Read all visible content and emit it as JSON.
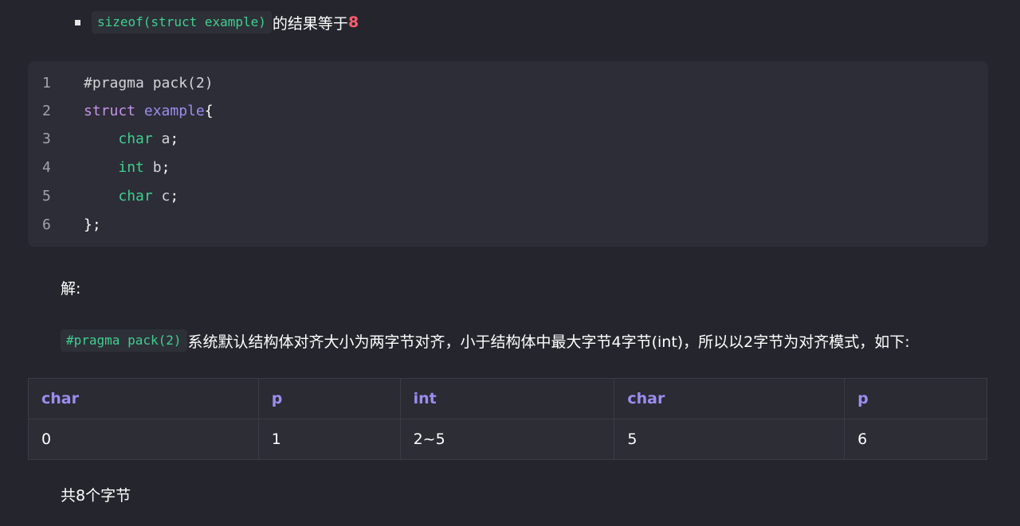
{
  "bullet": {
    "code": "sizeof(struct example)",
    "text": "的结果等于",
    "result": "8"
  },
  "code_block": {
    "lines": [
      {
        "n": "1",
        "parts": [
          "#pragma pack(2)"
        ]
      },
      {
        "n": "2",
        "parts": [
          "struct",
          " ",
          "example",
          "{"
        ]
      },
      {
        "n": "3",
        "parts": [
          "    ",
          "char",
          " a",
          ";"
        ]
      },
      {
        "n": "4",
        "parts": [
          "    ",
          "int",
          " b",
          ";"
        ]
      },
      {
        "n": "5",
        "parts": [
          "    ",
          "char",
          " c",
          ";"
        ]
      },
      {
        "n": "6",
        "parts": [
          "};"
        ]
      }
    ]
  },
  "solution_label": "解:",
  "explanation": {
    "code": "#pragma pack(2)",
    "text": "系统默认结构体对齐大小为两字节对齐，小于结构体中最大字节4字节(int)，所以以2字节为对齐模式，如下:"
  },
  "table": {
    "headers": [
      "char",
      "p",
      "int",
      "char",
      "p"
    ],
    "rows": [
      [
        "0",
        "1",
        "2~5",
        "5",
        "6"
      ]
    ]
  },
  "total": "共8个字节",
  "colors": {
    "background": "#25262d",
    "code_bg": "#2c2d36",
    "keyword": "#c792ea",
    "type": "#3ecf8e",
    "class_name": "#9d8cf0",
    "highlight_number": "#ff5c6c",
    "table_header": "#9d8cf0"
  }
}
